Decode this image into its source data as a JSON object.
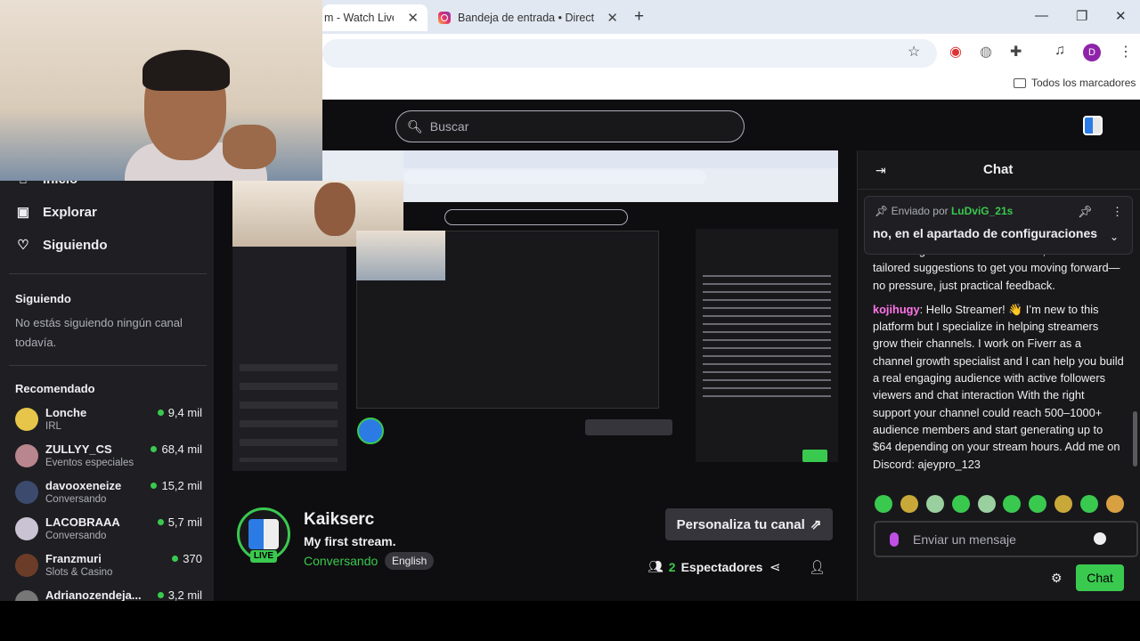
{
  "browser": {
    "tabs": [
      {
        "label": "m - Watch Live or"
      },
      {
        "label": "Bandeja de entrada • Direct"
      }
    ],
    "new_tab": "+",
    "bookmarks_label": "Todos los marcadores",
    "profile_initial": "D"
  },
  "header": {
    "search_placeholder": "Buscar"
  },
  "sidebar": {
    "nav": [
      {
        "label": "Inicio"
      },
      {
        "label": "Explorar"
      },
      {
        "label": "Siguiendo"
      }
    ],
    "following_heading": "Siguiendo",
    "following_empty": "No estás siguiendo ningún canal todavía.",
    "recommended_heading": "Recomendado",
    "channels": [
      {
        "name": "Lonche",
        "category": "IRL",
        "viewers": "9,4 mil"
      },
      {
        "name": "ZULLYY_CS",
        "category": "Eventos especiales",
        "viewers": "68,4 mil"
      },
      {
        "name": "davooxeneize",
        "category": "Conversando",
        "viewers": "15,2 mil"
      },
      {
        "name": "LACOBRAAA",
        "category": "Conversando",
        "viewers": "5,7 mil"
      },
      {
        "name": "Franzmuri",
        "category": "Slots & Casino",
        "viewers": "370"
      },
      {
        "name": "Adrianozendeja...",
        "category": "",
        "viewers": "3,2 mil"
      }
    ]
  },
  "stream": {
    "streamer": "Kaikserc",
    "title": "My first stream.",
    "category": "Conversando",
    "language": "English",
    "live_badge": "LIVE",
    "customize_button": "Personaliza tu canal",
    "viewers_count": "2",
    "viewers_label": "Espectadores"
  },
  "chat": {
    "title": "Chat",
    "pinned_prefix": "Enviado por",
    "pinned_user": "LuDviG_21s",
    "pinned_text": "no, en el apartado de configuraciones",
    "prev_message": "something else? Once I have that, I can offer tailored suggestions to get you moving forward—no pressure, just practical feedback.",
    "message_user": "kojihugy",
    "message_text": "Hello Streamer! 👋 I’m new to this platform but I specialize in helping streamers grow their channels. I work on Fiverr as a channel growth specialist and I can help you build a real engaging audience with active followers viewers and chat interaction With the right support your channel could reach 500–1000+ audience members and start generating up to $64 depending on your stream hours. Add me on Discord: ajeypro_123",
    "input_placeholder": "Enviar un mensaje",
    "send_button": "Chat"
  }
}
